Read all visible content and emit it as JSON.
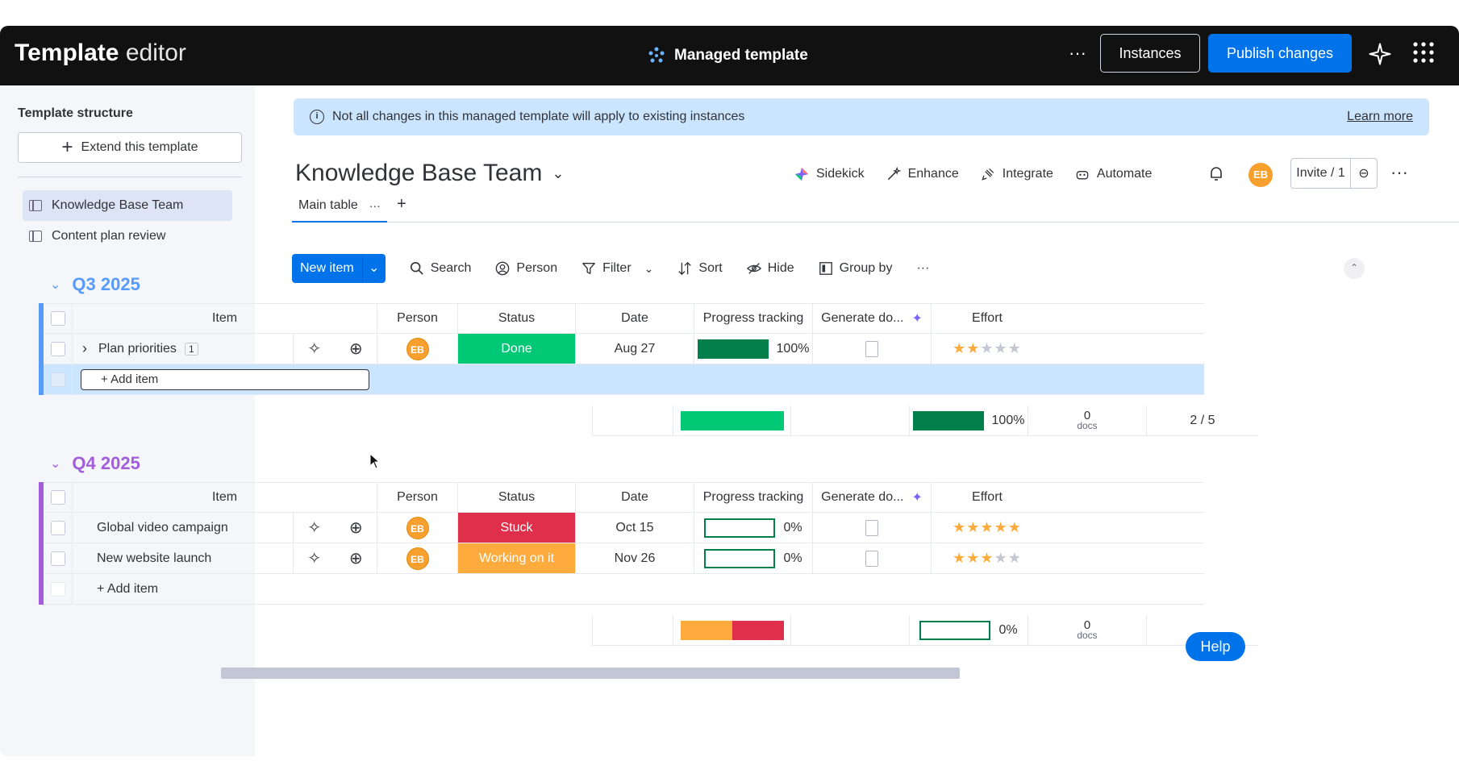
{
  "topbar": {
    "title_bold": "Template",
    "title_light": " editor",
    "managed_label": "Managed template",
    "more": "···",
    "instances_label": "Instances",
    "publish_label": "Publish changes"
  },
  "sidebar": {
    "title": "Template structure",
    "extend_label": "Extend this template",
    "items": [
      {
        "label": "Knowledge Base Team"
      },
      {
        "label": "Content plan review"
      }
    ]
  },
  "banner": {
    "text": "Not all changes in this managed template will apply to existing instances",
    "learn_more": "Learn more"
  },
  "board": {
    "title": "Knowledge Base Team",
    "actions": {
      "sidekick": "Sidekick",
      "enhance": "Enhance",
      "integrate": "Integrate",
      "automate": "Automate"
    },
    "avatar": "EB",
    "invite_label": "Invite / 1",
    "more": "···"
  },
  "tabs": {
    "main_table": "Main table",
    "more": "···",
    "add": "+"
  },
  "toolbar": {
    "new_item": "New item",
    "search": "Search",
    "person": "Person",
    "filter": "Filter",
    "sort": "Sort",
    "hide": "Hide",
    "group_by": "Group by",
    "more": "···"
  },
  "columns": {
    "item": "Item",
    "person": "Person",
    "status": "Status",
    "date": "Date",
    "progress": "Progress tracking",
    "generate": "Generate do...",
    "effort": "Effort"
  },
  "groups": [
    {
      "name": "Q3 2025",
      "color": "#579bfc",
      "rows": [
        {
          "item": "Plan priorities",
          "subitems": "1",
          "person": "EB",
          "status": "Done",
          "status_color": "#00c875",
          "date": "Aug 27",
          "progress": 100,
          "progress_label": "100%",
          "effort": 2
        }
      ],
      "add_item": "+ Add item",
      "summary": {
        "progress_label": "100%",
        "docs_count": "0",
        "docs_unit": "docs",
        "effort": "2 / 5"
      }
    },
    {
      "name": "Q4 2025",
      "color": "#a25ddc",
      "rows": [
        {
          "item": "Global video campaign",
          "person": "EB",
          "status": "Stuck",
          "status_color": "#df2f4a",
          "date": "Oct 15",
          "progress": 0,
          "progress_label": "0%",
          "effort": 5
        },
        {
          "item": "New website launch",
          "person": "EB",
          "status": "Working on it",
          "status_color": "#fdab3d",
          "date": "Nov 26",
          "progress": 0,
          "progress_label": "0%",
          "effort": 3
        }
      ],
      "add_item": "+ Add item",
      "summary": {
        "progress_label": "0%",
        "docs_count": "0",
        "docs_unit": "docs"
      }
    }
  ],
  "help_label": "Help"
}
